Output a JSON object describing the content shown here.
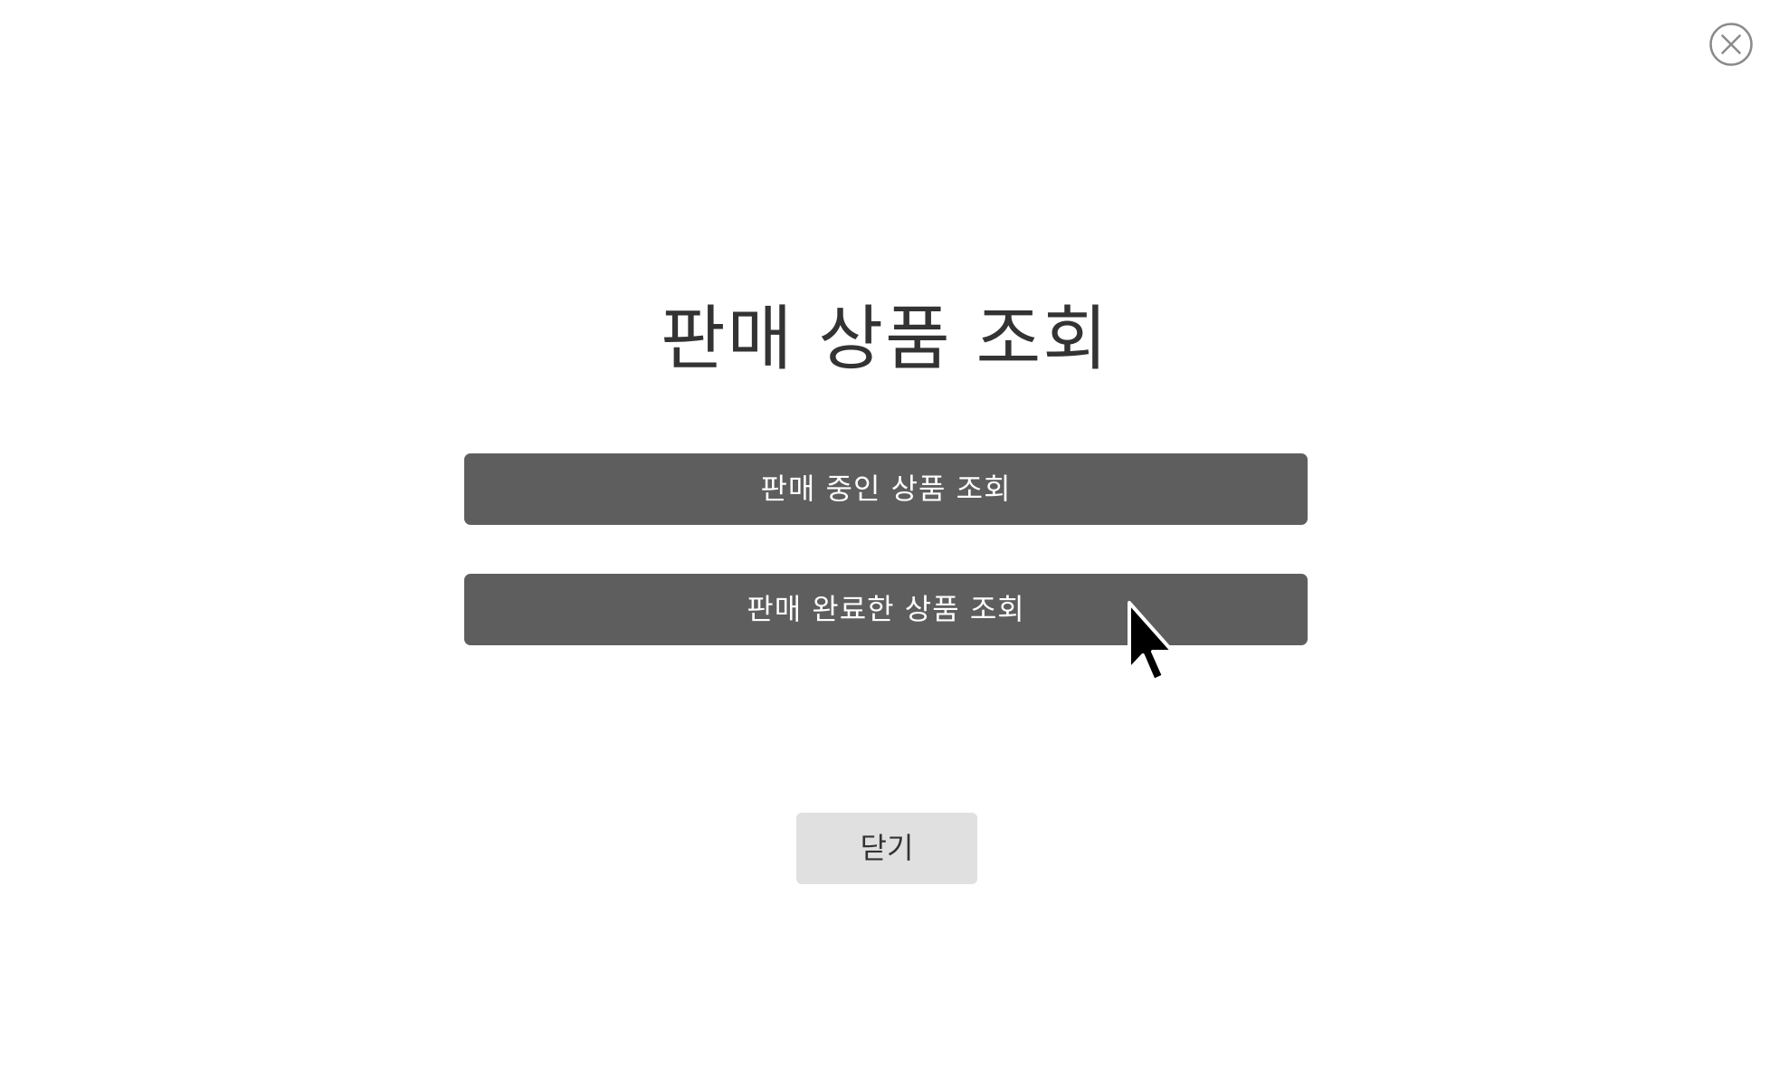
{
  "dialog": {
    "title": "판매 상품 조회",
    "buttons": {
      "selling_label": "판매 중인 상품 조회",
      "sold_label": "판매 완료한 상품 조회",
      "close_label": "닫기"
    }
  },
  "icons": {
    "close": "close-icon",
    "cursor": "mouse-cursor-icon"
  },
  "colors": {
    "primary_button": "#5e5e5e",
    "secondary_button": "#e0e0e0",
    "title_text": "#333333"
  }
}
